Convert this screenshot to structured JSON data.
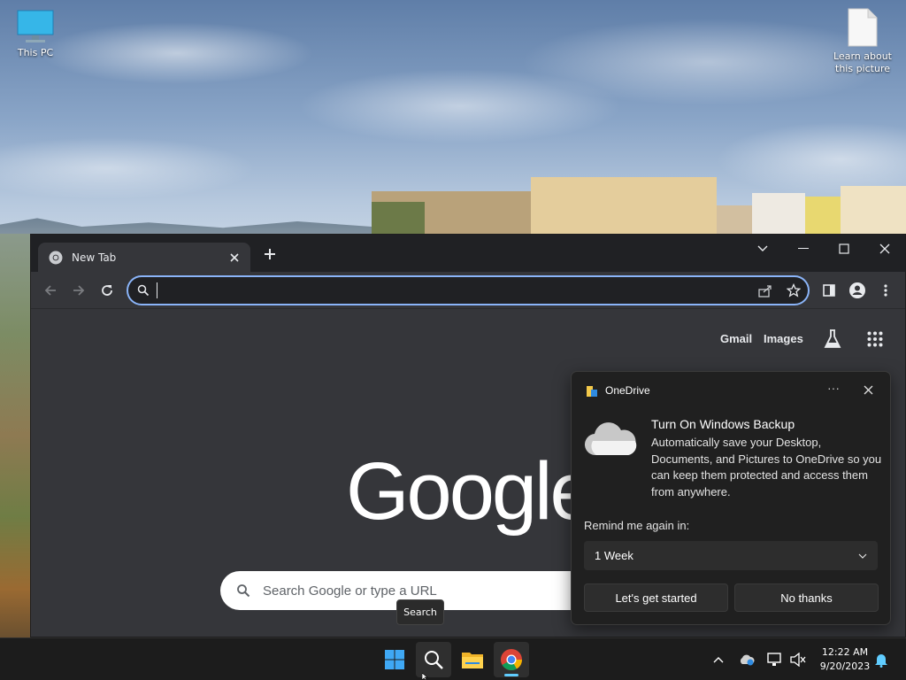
{
  "desktop": {
    "icons": [
      {
        "label": "This PC"
      },
      {
        "label_line1": "Learn about",
        "label_line2": "this picture"
      }
    ]
  },
  "browser": {
    "tab_title": "New Tab",
    "omnibox_value": "",
    "links": {
      "gmail": "Gmail",
      "images": "Images"
    },
    "logo_text": "Google",
    "search_placeholder": "Search Google or type a URL",
    "accent_color": "#8ab4f8"
  },
  "tooltip": {
    "text": "Search"
  },
  "toast": {
    "app_name": "OneDrive",
    "title": "Turn On Windows Backup",
    "body": "Automatically save your Desktop, Documents, and Pictures to OneDrive so you can keep them protected and access them from anywhere.",
    "remind_label": "Remind me again in:",
    "remind_value": "1 Week",
    "primary_button": "Let's get started",
    "secondary_button": "No thanks",
    "more_label": "···"
  },
  "taskbar": {
    "apps": [
      "windows-start-icon",
      "search-icon",
      "file-explorer-icon",
      "chrome-icon"
    ],
    "time": "12:22 AM",
    "date": "9/20/2023"
  }
}
